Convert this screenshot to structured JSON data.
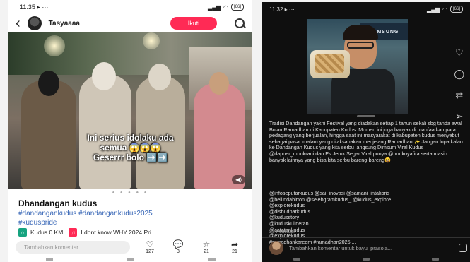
{
  "left": {
    "status": {
      "time": "11:35",
      "extra": "▸ ···",
      "battery": "[66]"
    },
    "header": {
      "username": "Tasyaaaa",
      "follow_label": "Ikuti"
    },
    "overlay_line1": "Ini serius idolaku ada",
    "overlay_line2": "semua 😱😱😱",
    "overlay_line3": "Geserrr bolo ➡️➡️",
    "title": "Dhandangan kudus",
    "tags_line1": "#dandangankudus #dandangankudus2025",
    "tags_line2": "#kuduspride",
    "chip_location": "Kudus 0 KM",
    "chip_music": "I dont know WHY 2024 Pri...",
    "comment_placeholder": "Tambahkan komentar...",
    "actions": [
      {
        "icon": "♡",
        "count": "127"
      },
      {
        "icon": "💬",
        "count": "3"
      },
      {
        "icon": "☆",
        "count": "21"
      },
      {
        "icon": "➦",
        "count": "21"
      }
    ],
    "colors": {
      "follow": "#ff2a55",
      "hashtag": "#3665b6"
    }
  },
  "right": {
    "status": {
      "time": "11:32",
      "extra": "▸ ···",
      "battery": "[66]"
    },
    "sign_text": "SAMSUNG",
    "description": "Tradisi Dandangan yakni Festival yang diadakan setiap 1 tahun sekali sbg tanda awal Bulan Ramadhan di Kabupaten Kudus. Momen ini juga banyak di manfaatkan para pedagang yang berjualan, hingga saat ini masyarakat di kabupaten kudus menyebut sebagai pasar malam yang dilaksanakan menjelang Ramadhan.✨ Jangan lupa kalau ke Dandangan Kudus yang kita serbu langsung Dimsum Viral Kudus @dapoer_mpokrani dan Es Jeruk Segar Viral punya @norikoyafira serta masih banyak lainnya yang bisa kita serbu bareng-bareng😆",
    "mentions": [
      "@infoseputarkudus @sai_inovasi @samani_intakoris",
      "@bellindabirton @selebgramkudus_ @kudus_explore",
      "@explorekudus",
      "@disbudparkudus",
      "@kudusstory",
      "@kuduskulineran",
      "@catatankudus",
      "@explorekudus",
      "#ramadhankareem #ramadhan2025 ..."
    ],
    "date": "25 Februari",
    "comment_placeholder": "Tambahkan komentar untuk bayu_prasoja..."
  }
}
